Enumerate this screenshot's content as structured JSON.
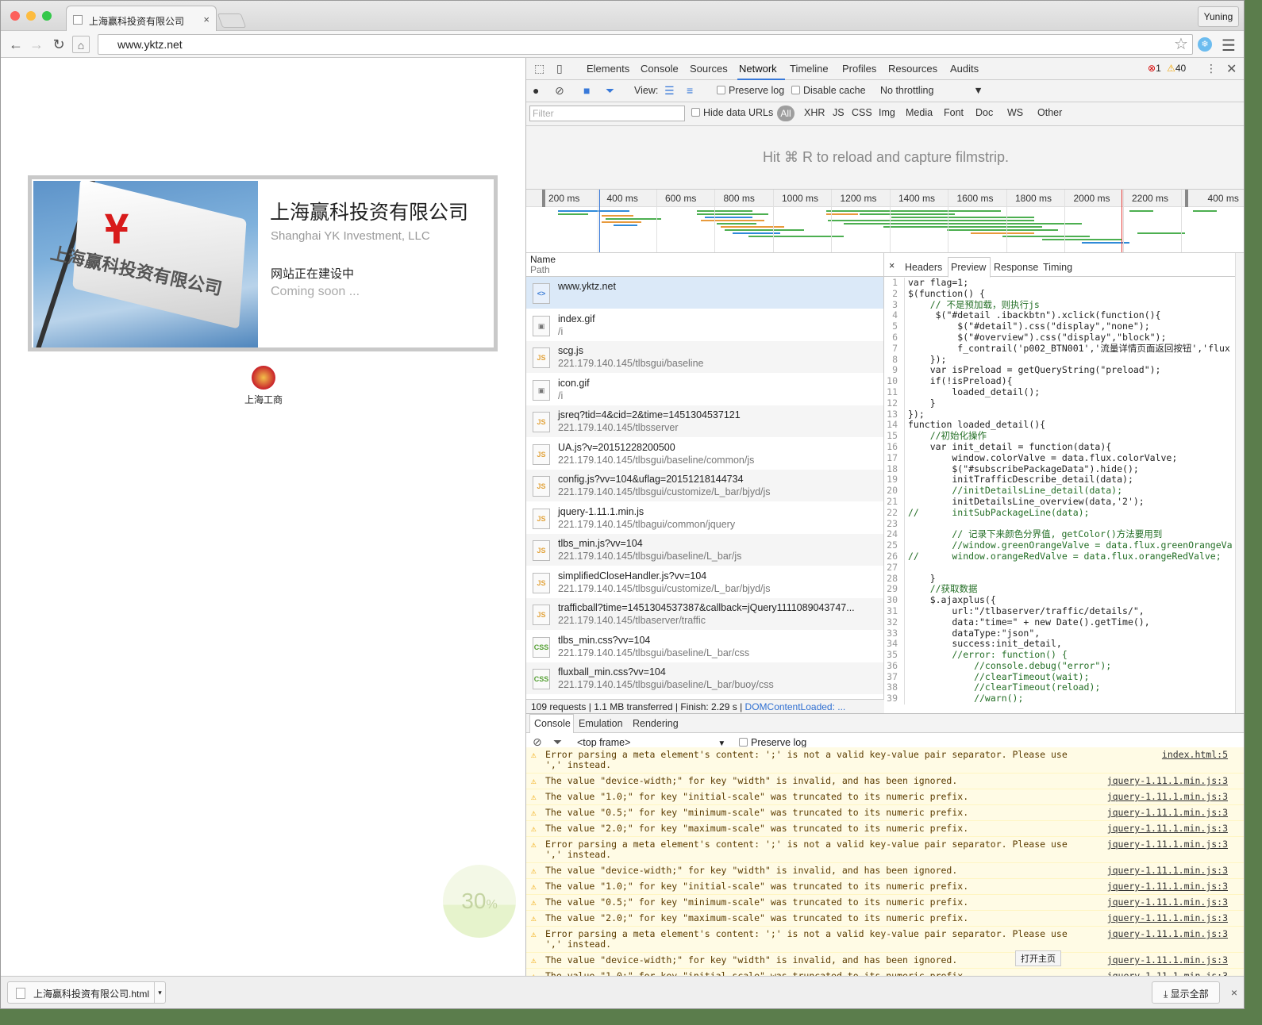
{
  "browser": {
    "tab_title": "上海赢科投资有限公司",
    "tab_close": "×",
    "user": "Yuning",
    "url": "www.yktz.net"
  },
  "page": {
    "company_name": "上海赢科投资有限公司",
    "company_en": "Shanghai YK Investment, LLC",
    "building": "网站正在建设中",
    "coming_soon": "Coming soon ...",
    "flag_mark": "Ұ",
    "flag_text": "上海赢科投资有限公司",
    "badge_label": "上海工商",
    "progress_value": "30",
    "progress_unit": "%"
  },
  "devtools": {
    "tabs": [
      "Elements",
      "Console",
      "Sources",
      "Network",
      "Timeline",
      "Profiles",
      "Resources",
      "Audits"
    ],
    "selected_tab": "Network",
    "errors": "1",
    "warnings": "40",
    "netbar": {
      "view_label": "View:",
      "preserve_log": "Preserve log",
      "disable_cache": "Disable cache",
      "throttling": "No throttling"
    },
    "filter": {
      "placeholder": "Filter",
      "hide_data_urls": "Hide data URLs",
      "types": [
        "All",
        "XHR",
        "JS",
        "CSS",
        "Img",
        "Media",
        "Font",
        "Doc",
        "WS",
        "Other"
      ]
    },
    "filmstrip_hint": "Hit ⌘ R to reload and capture filmstrip.",
    "ruler_ticks": [
      "200 ms",
      "400 ms",
      "600 ms",
      "800 ms",
      "1000 ms",
      "1200 ms",
      "1400 ms",
      "1600 ms",
      "1800 ms",
      "2000 ms",
      "2200 ms",
      "400 ms"
    ],
    "list_header": {
      "name": "Name",
      "path": "Path"
    },
    "requests": [
      {
        "name": "www.yktz.net",
        "path": "",
        "type": "html"
      },
      {
        "name": "index.gif",
        "path": "/i",
        "type": "img"
      },
      {
        "name": "scg.js",
        "path": "221.179.140.145/tlbsgui/baseline",
        "type": "js"
      },
      {
        "name": "icon.gif",
        "path": "/i",
        "type": "img"
      },
      {
        "name": "jsreq?tid=4&cid=2&time=1451304537121",
        "path": "221.179.140.145/tlbsserver",
        "type": "js"
      },
      {
        "name": "UA.js?v=20151228200500",
        "path": "221.179.140.145/tlbsgui/baseline/common/js",
        "type": "js"
      },
      {
        "name": "config.js?vv=104&uflag=20151218144734",
        "path": "221.179.140.145/tlbsgui/customize/L_bar/bjyd/js",
        "type": "js"
      },
      {
        "name": "jquery-1.11.1.min.js",
        "path": "221.179.140.145/tlbagui/common/jquery",
        "type": "js"
      },
      {
        "name": "tlbs_min.js?vv=104",
        "path": "221.179.140.145/tlbsgui/baseline/L_bar/js",
        "type": "js"
      },
      {
        "name": "simplifiedCloseHandler.js?vv=104",
        "path": "221.179.140.145/tlbsgui/customize/L_bar/bjyd/js",
        "type": "js"
      },
      {
        "name": "trafficball?time=1451304537387&callback=jQuery1111089043747...",
        "path": "221.179.140.145/tlbaserver/traffic",
        "type": "js"
      },
      {
        "name": "tlbs_min.css?vv=104",
        "path": "221.179.140.145/tlbsgui/baseline/L_bar/css",
        "type": "css"
      },
      {
        "name": "fluxball_min.css?vv=104",
        "path": "221.179.140.145/tlbsgui/baseline/L_bar/buoy/css",
        "type": "css"
      }
    ],
    "status": {
      "requests": "109 requests",
      "transferred": "1.1 MB transferred",
      "finish": "Finish: 2.29 s",
      "dom": "DOMContentLoaded: ..."
    },
    "preview_tabs": [
      "Headers",
      "Preview",
      "Response",
      "Timing"
    ],
    "preview_close": "×",
    "code_lines": [
      "var flag=1;",
      "$(function() {",
      "    // 不是预加载，则执行js",
      "     $(\"#detail .ibackbtn\").xclick(function(){",
      "         $(\"#detail\").css(\"display\",\"none\");",
      "         $(\"#overview\").css(\"display\",\"block\");",
      "         f_contrail('p002_BTN001','流量详情页面返回按钮','flux",
      "    });",
      "    var isPreload = getQueryString(\"preload\");",
      "    if(!isPreload){",
      "        loaded_detail();",
      "    }",
      "});",
      "function loaded_detail(){",
      "    //初始化操作",
      "    var init_detail = function(data){",
      "        window.colorValve = data.flux.colorValve;",
      "        $(\"#subscribePackageData\").hide();",
      "        initTrafficDescribe_detail(data);",
      "        //initDetailsLine_detail(data);",
      "        initDetailsLine_overview(data,'2');",
      "//      initSubPackageLine(data);",
      "",
      "        // 记录下来颜色分界值, getColor()方法要用到",
      "        //window.greenOrangeValve = data.flux.greenOrangeVa",
      "//      window.orangeRedValve = data.flux.orangeRedValve;",
      "",
      "    }",
      "    //获取数据",
      "    $.ajaxplus({",
      "        url:\"/tlbaserver/traffic/details/\",",
      "        data:\"time=\" + new Date().getTime(),",
      "        dataType:\"json\",",
      "        success:init_detail,",
      "        //error: function() {",
      "            //console.debug(\"error\");",
      "            //clearTimeout(wait);",
      "            //clearTimeout(reload);",
      "            //warn();"
    ],
    "drawer_tabs": [
      "Console",
      "Emulation",
      "Rendering"
    ],
    "console_frame": "<top frame>",
    "console_preserve": "Preserve log",
    "console_messages": [
      {
        "text": "Error parsing a meta element's content: ';' is not a valid key-value pair separator. Please use ',' instead.",
        "src": "index.html:5"
      },
      {
        "text": "The value \"device-width;\" for key \"width\" is invalid, and has been ignored.",
        "src": "jquery-1.11.1.min.js:3"
      },
      {
        "text": "The value \"1.0;\" for key \"initial-scale\" was truncated to its numeric prefix.",
        "src": "jquery-1.11.1.min.js:3"
      },
      {
        "text": "The value \"0.5;\" for key \"minimum-scale\" was truncated to its numeric prefix.",
        "src": "jquery-1.11.1.min.js:3"
      },
      {
        "text": "The value \"2.0;\" for key \"maximum-scale\" was truncated to its numeric prefix.",
        "src": "jquery-1.11.1.min.js:3"
      },
      {
        "text": "Error parsing a meta element's content: ';' is not a valid key-value pair separator. Please use ',' instead.",
        "src": "jquery-1.11.1.min.js:3"
      },
      {
        "text": "The value \"device-width;\" for key \"width\" is invalid, and has been ignored.",
        "src": "jquery-1.11.1.min.js:3"
      },
      {
        "text": "The value \"1.0;\" for key \"initial-scale\" was truncated to its numeric prefix.",
        "src": "jquery-1.11.1.min.js:3"
      },
      {
        "text": "The value \"0.5;\" for key \"minimum-scale\" was truncated to its numeric prefix.",
        "src": "jquery-1.11.1.min.js:3"
      },
      {
        "text": "The value \"2.0;\" for key \"maximum-scale\" was truncated to its numeric prefix.",
        "src": "jquery-1.11.1.min.js:3"
      },
      {
        "text": "Error parsing a meta element's content: ';' is not a valid key-value pair separator. Please use ',' instead.",
        "src": "jquery-1.11.1.min.js:3"
      },
      {
        "text": "The value \"device-width;\" for key \"width\" is invalid, and has been ignored.",
        "src": "jquery-1.11.1.min.js:3"
      },
      {
        "text": "The value \"1.0;\" for key \"initial-scale\" was truncated to its numeric prefix.",
        "src": "jquery-1.11.1.min.js:3"
      }
    ],
    "tooltip": "打开主页"
  },
  "shelf": {
    "download_name": "上海赢科投资有限公司.html",
    "show_all": "显示全部",
    "close": "×"
  },
  "colors": {
    "accent": "#3879d9",
    "warning_bg": "#fffbe5",
    "selected_row": "#dbe9f8"
  }
}
